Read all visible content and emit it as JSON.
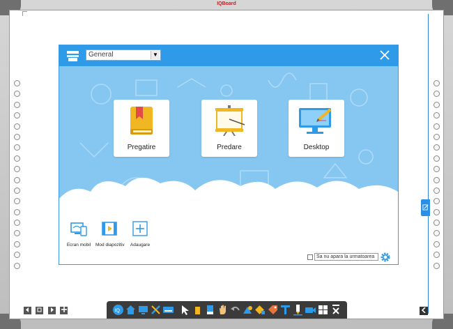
{
  "window": {
    "brand": "IQBoard"
  },
  "dialog": {
    "category_select": {
      "value": "General"
    },
    "tiles": [
      {
        "label": "Pregatire",
        "icon": "book-icon"
      },
      {
        "label": "Predare",
        "icon": "presentation-board-icon"
      },
      {
        "label": "Desktop",
        "icon": "monitor-pen-icon"
      }
    ],
    "bottom_items": [
      {
        "label": "Ecran mobil",
        "icon": "mobile-screen-icon"
      },
      {
        "label": "Mod diapozitiv",
        "icon": "slideshow-icon"
      },
      {
        "label": "Adaugare",
        "icon": "add-icon"
      }
    ],
    "dont_show_label": "Sa nu apara la urmatoarea",
    "dont_show_checked": false
  },
  "colors": {
    "header": "#2f9ae8",
    "body": "#86c7f2",
    "toolbar": "#3b3b3b"
  }
}
